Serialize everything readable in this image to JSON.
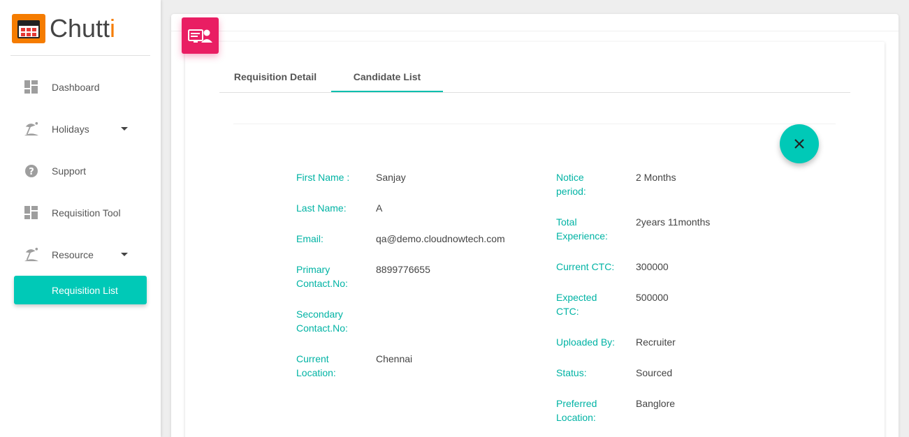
{
  "logo": {
    "text_main": "Chutt",
    "text_accent": "i"
  },
  "sidebar": {
    "items": [
      {
        "label": "Dashboard",
        "icon": "dashboard-icon"
      },
      {
        "label": "Holidays",
        "icon": "beach-icon",
        "has_caret": true
      },
      {
        "label": "Support",
        "icon": "help-icon"
      },
      {
        "label": "Requisition Tool",
        "icon": "dashboard-icon"
      },
      {
        "label": "Resource",
        "icon": "beach-icon",
        "has_caret": true
      }
    ],
    "active_subitem": "Requisition List"
  },
  "tabs": [
    {
      "label": "Requisition Detail",
      "active": false
    },
    {
      "label": "Candidate List",
      "active": true
    }
  ],
  "candidate": {
    "left": [
      {
        "label": "First Name :",
        "value": "Sanjay"
      },
      {
        "label": "Last Name:",
        "value": "A"
      },
      {
        "label": "Email:",
        "value": "qa@demo.cloudnowtech.com"
      },
      {
        "label": "Primary Contact.No:",
        "value": "8899776655"
      },
      {
        "label": "Secondary Contact.No:",
        "value": ""
      },
      {
        "label": "Current Location:",
        "value": "Chennai"
      }
    ],
    "right": [
      {
        "label": "Notice period:",
        "value": "2 Months"
      },
      {
        "label": "Total Experience:",
        "value": "2years 11months"
      },
      {
        "label": "Current CTC:",
        "value": "300000"
      },
      {
        "label": "Expected CTC:",
        "value": "500000"
      },
      {
        "label": "Uploaded By:",
        "value": "Recruiter"
      },
      {
        "label": "Status:",
        "value": "Sourced"
      },
      {
        "label": "Preferred Location:",
        "value": "Banglore"
      }
    ]
  },
  "colors": {
    "accent": "#00c9b7",
    "label": "#00b3a4",
    "card_icon": "#e91e63",
    "logo": "#f57c00"
  }
}
